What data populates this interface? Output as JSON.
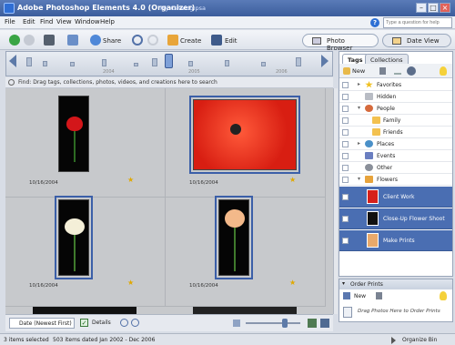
{
  "titlebar": {
    "app_title": "Adobe Photoshop Elements 4.0 (Organizer)",
    "catalog": "My Catalog.psa"
  },
  "menubar": {
    "items": [
      "File",
      "Edit",
      "Find",
      "View",
      "Window",
      "Help"
    ],
    "help_search_placeholder": "Type a question for help"
  },
  "toolbar": {
    "share_label": "Share",
    "create_label": "Create",
    "edit_label": "Edit",
    "photo_browser_label": "Photo Browser",
    "date_view_label": "Date View"
  },
  "timeline": {
    "years": [
      "2004",
      "2005",
      "2006"
    ]
  },
  "findbar": {
    "text": "Find: Drag tags, collections, photos, videos, and creations here to search"
  },
  "photos": [
    {
      "date": "10/16/2004",
      "subject": "red rose on black"
    },
    {
      "date": "10/16/2004",
      "subject": "red rose close-up"
    },
    {
      "date": "10/16/2004",
      "subject": "white rose on black"
    },
    {
      "date": "10/16/2004",
      "subject": "peach rose on black"
    }
  ],
  "bottombar": {
    "sort_label": "Date (Newest First)",
    "details_label": "Details"
  },
  "status": {
    "left": "3 items selected",
    "middle": "503 items dated Jan 2002 - Dec 2006",
    "organize_bin": "Organize Bin"
  },
  "panel": {
    "tabs": [
      "Tags",
      "Collections"
    ],
    "new_label": "New",
    "tags": [
      {
        "label": "Favorites"
      },
      {
        "label": "Hidden"
      },
      {
        "label": "People"
      },
      {
        "label": "Family"
      },
      {
        "label": "Friends"
      },
      {
        "label": "Places"
      },
      {
        "label": "Events"
      },
      {
        "label": "Other"
      },
      {
        "label": "Flowers"
      }
    ],
    "flower_tags": [
      "Client Work",
      "Close-Up Flower Shoot",
      "Make Prints"
    ]
  },
  "order_prints": {
    "title": "Order Prints",
    "new_label": "New",
    "hint": "Drag Photos Here to Order Prints"
  },
  "colors": {
    "accent": "#4a6eb2",
    "title_bar": "#3b5d9c",
    "selection": "#3b5fa8"
  }
}
